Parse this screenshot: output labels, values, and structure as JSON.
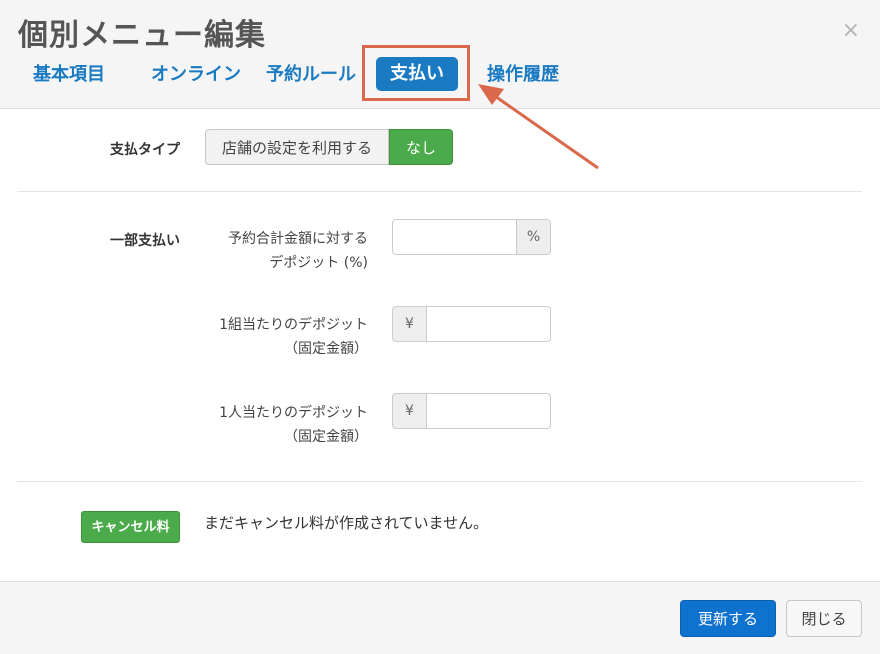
{
  "dialog": {
    "title": "個別メニュー編集",
    "close_label": "×"
  },
  "tabs": [
    {
      "label": "基本項目",
      "active": false
    },
    {
      "label": "オンライン",
      "active": false
    },
    {
      "label": "予約ルール",
      "active": false
    },
    {
      "label": "支払い",
      "active": true
    },
    {
      "label": "操作履歴",
      "active": false
    }
  ],
  "payment_type": {
    "label": "支払タイプ",
    "options": [
      "店舗の設定を利用する",
      "なし"
    ],
    "selected": "なし"
  },
  "partial_payment": {
    "label": "一部支払い",
    "fields": [
      {
        "label_line1": "予約合計金額に対する",
        "label_line2": "デポジット (%)",
        "addon": "%",
        "addon_side": "right",
        "value": ""
      },
      {
        "label_line1": "1組当たりのデポジット",
        "label_line2": "（固定金額）",
        "addon": "¥",
        "addon_side": "left",
        "value": ""
      },
      {
        "label_line1": "1人当たりのデポジット",
        "label_line2": "（固定金額）",
        "addon": "¥",
        "addon_side": "left",
        "value": ""
      }
    ]
  },
  "cancel_fee": {
    "badge": "キャンセル料",
    "message": "まだキャンセル料が作成されていません。"
  },
  "footer": {
    "update_label": "更新する",
    "close_label": "閉じる"
  },
  "colors": {
    "accent": "#1a7ac2",
    "success": "#4bab4b",
    "highlight": "#d9694a",
    "primary_button": "#1072cf"
  }
}
